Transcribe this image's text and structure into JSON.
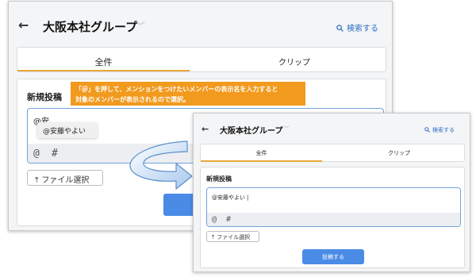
{
  "back_icon": "←",
  "group": {
    "name": "大阪本社グループ",
    "chevron": "﹀"
  },
  "search": {
    "icon": "magnifier-icon",
    "label": "検索する"
  },
  "tabs": [
    {
      "label": "全件"
    },
    {
      "label": "クリップ"
    }
  ],
  "post": {
    "heading": "新規投稿",
    "typed_text": "@安",
    "suggestion": "@安藤やよい",
    "completed_text": "@安藤やよい",
    "at_symbol": "@",
    "hash_symbol": "#",
    "file_button": "ファイル選択",
    "submit_button": "投稿する",
    "submit_partial": "投"
  },
  "callout": {
    "line1": "「＠」を押して、メンションをつけたいメンバーの表示名を入力すると",
    "line2": "対象のメンバーが表示されるので選択。"
  },
  "colors": {
    "accent": "#e6a93a",
    "primary": "#4a8be6",
    "link": "#2f6fc4",
    "callout": "#f29a1e"
  }
}
